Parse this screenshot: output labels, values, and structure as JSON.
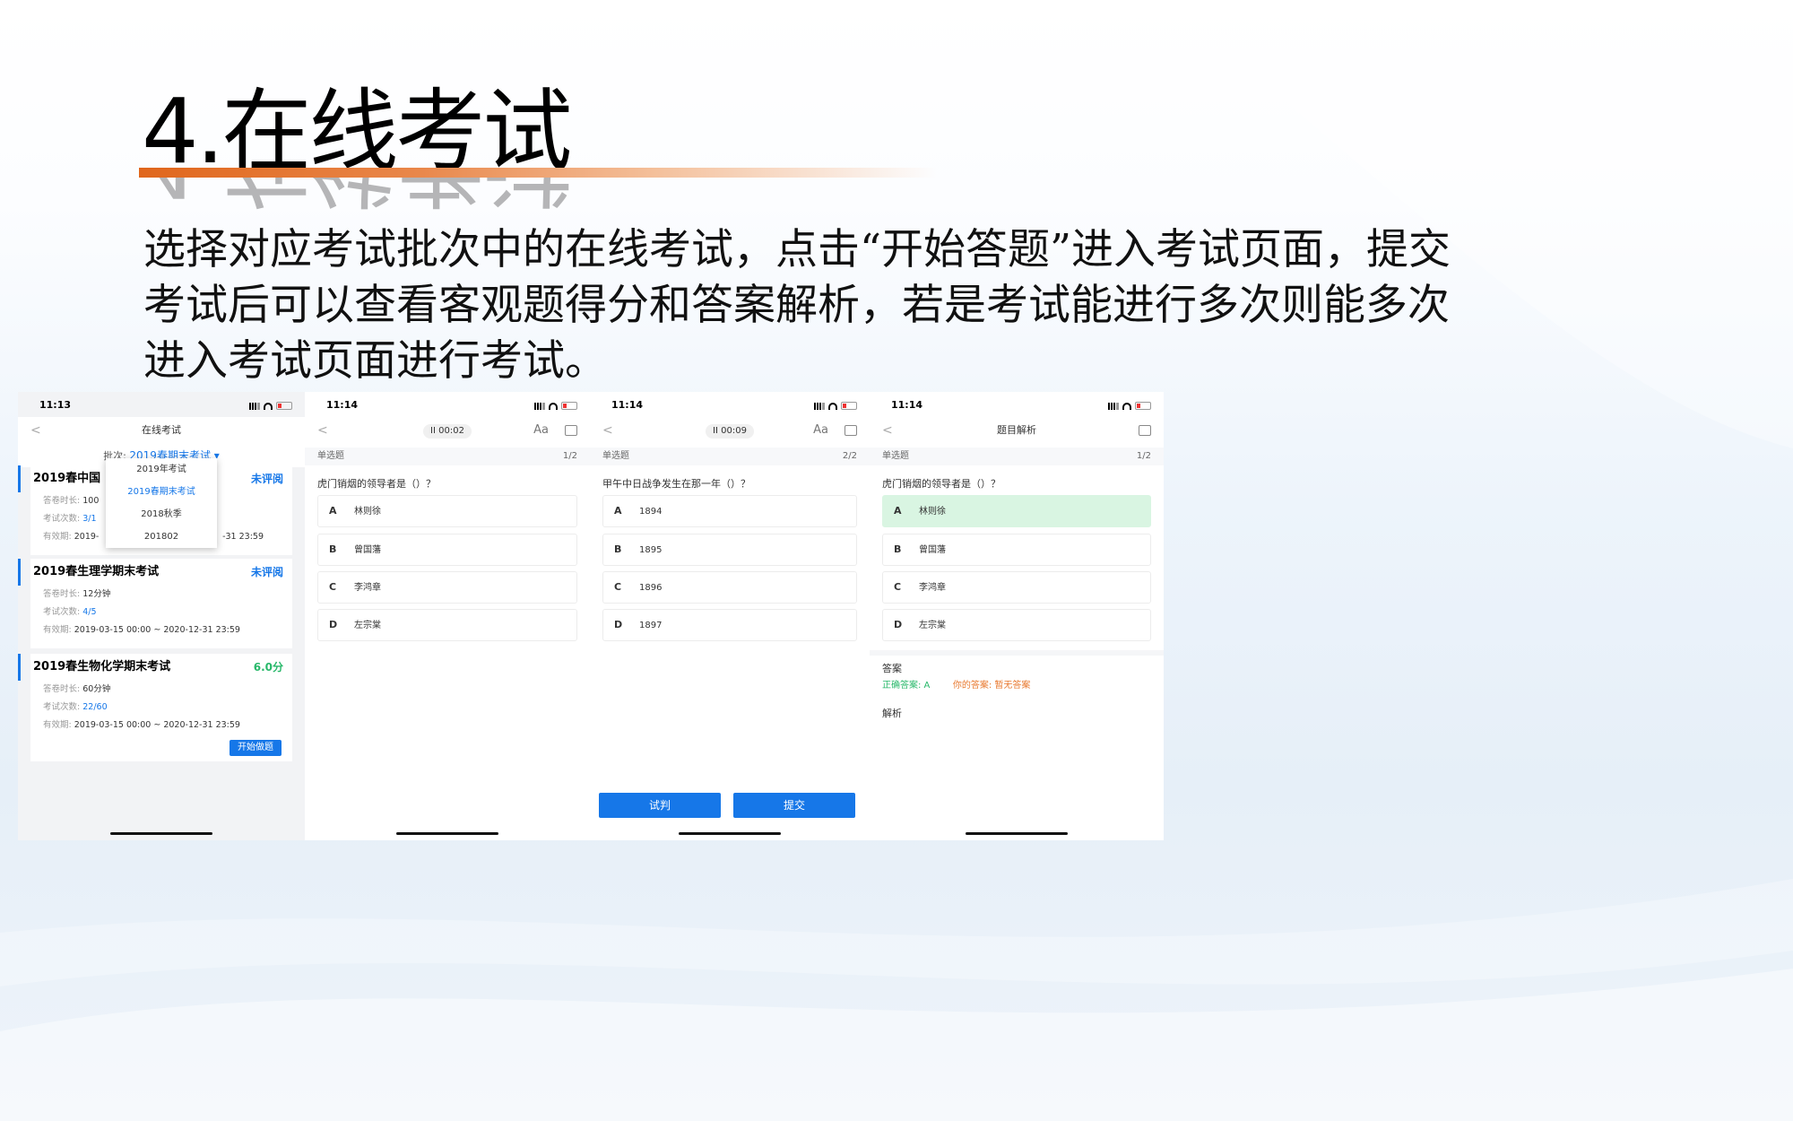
{
  "slide": {
    "title": "4.在线考试",
    "description": "选择对应考试批次中的在线考试，点击“开始答题”进入考试页面，提交考试后可以查看客观题得分和答案解析，若是考试能进行多次则能多次进入考试页面进行考试。"
  },
  "screen1": {
    "time": "11:13",
    "nav_title": "在线考试",
    "back": "<",
    "batch_label": "批次:",
    "batch_value": "2019春期末考试 ▾",
    "dropdown": [
      "2019年考试",
      "2019春期末考试",
      "2018秋季",
      "201802"
    ],
    "exams": [
      {
        "title": "2019春中国",
        "status": "未评阅",
        "duration_label": "答卷时长:",
        "duration": "100",
        "attempts_label": "考试次数:",
        "attempts": "3/1",
        "valid_label": "有效期:",
        "valid": "2019-",
        "valid_tail": "-31 23:59"
      },
      {
        "title": "2019春生理学期末考试",
        "status": "未评阅",
        "duration_label": "答卷时长:",
        "duration": "12分钟",
        "attempts_label": "考试次数:",
        "attempts": "4/5",
        "valid_label": "有效期:",
        "valid": "2019-03-15 00:00 ~ 2020-12-31 23:59"
      },
      {
        "title": "2019春生物化学期末考试",
        "status": "6.0分",
        "duration_label": "答卷时长:",
        "duration": "60分钟",
        "attempts_label": "考试次数:",
        "attempts": "22/60",
        "valid_label": "有效期:",
        "valid": "2019-03-15 00:00 ~ 2020-12-31 23:59",
        "button": "开始做题"
      }
    ]
  },
  "screen2": {
    "time": "11:14",
    "timer": "II 00:02",
    "font_btn": "Aa",
    "qtype": "单选题",
    "qnum": "1/2",
    "question": "虎门销烟的领导者是（）？",
    "options": [
      {
        "letter": "A",
        "text": "林则徐"
      },
      {
        "letter": "B",
        "text": "曾国藩"
      },
      {
        "letter": "C",
        "text": "李鸿章"
      },
      {
        "letter": "D",
        "text": "左宗棠"
      }
    ]
  },
  "screen3": {
    "time": "11:14",
    "timer": "II 00:09",
    "font_btn": "Aa",
    "qtype": "单选题",
    "qnum": "2/2",
    "question": "甲午中日战争发生在那一年（）？",
    "options": [
      {
        "letter": "A",
        "text": "1894"
      },
      {
        "letter": "B",
        "text": "1895"
      },
      {
        "letter": "C",
        "text": "1896"
      },
      {
        "letter": "D",
        "text": "1897"
      }
    ],
    "btn_try": "试判",
    "btn_submit": "提交"
  },
  "screen4": {
    "time": "11:14",
    "nav_title": "题目解析",
    "qtype": "单选题",
    "qnum": "1/2",
    "question": "虎门销烟的领导者是（）？",
    "options": [
      {
        "letter": "A",
        "text": "林则徐"
      },
      {
        "letter": "B",
        "text": "曾国藩"
      },
      {
        "letter": "C",
        "text": "李鸿章"
      },
      {
        "letter": "D",
        "text": "左宗棠"
      }
    ],
    "answer_heading": "答案",
    "correct_label": "正确答案: A",
    "your_label": "你的答案: 暂无答案",
    "analysis_heading": "解析"
  },
  "colors": {
    "accent_blue": "#1677e8",
    "title_bar_orange": "#e0661c",
    "correct_green": "#28b86a",
    "your_answer_orange": "#e8782e"
  }
}
